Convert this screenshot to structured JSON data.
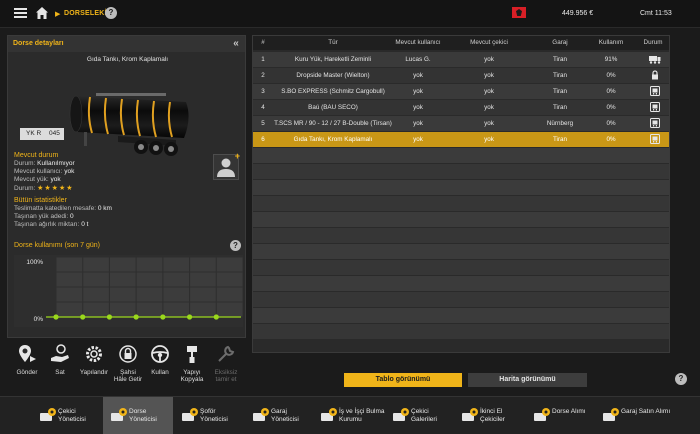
{
  "topbar": {
    "breadcrumb": "DORSELEKİM",
    "breadcrumb_sep": "▶",
    "help": "?",
    "money": "449.956 €",
    "time": "Cmt 11:53"
  },
  "left_panel": {
    "title": "Dorse detayları",
    "collapse": "«",
    "trailer_name": "Gıda Tankı, Krom Kaplamalı",
    "plate": {
      "country": "YK R",
      "number": "045"
    },
    "status": {
      "title": "Mevcut durum",
      "rows": [
        {
          "label": "Durum:",
          "value": "Kullanılmıyor"
        },
        {
          "label": "Mevcut kullanıcı:",
          "value": "yok"
        },
        {
          "label": "Mevcut yük:",
          "value": "yok"
        },
        {
          "label": "Durum:",
          "value": "★★★★★"
        }
      ]
    },
    "stats": {
      "title": "Bütün istatistikler",
      "rows": [
        {
          "label": "Teslimatta katedilen mesafe:",
          "value": "0 km"
        },
        {
          "label": "Taşınan yük adedi:",
          "value": "0"
        },
        {
          "label": "Taşınan ağırlık miktarı:",
          "value": "0 t"
        }
      ]
    },
    "usage": {
      "title": "Dorse kullanımı (son 7 gün)",
      "help": "?",
      "y_max_label": "100%",
      "y_min_label": "0%"
    }
  },
  "chart_data": {
    "type": "line",
    "title": "Dorse kullanımı (son 7 gün)",
    "x": [
      1,
      2,
      3,
      4,
      5,
      6,
      7
    ],
    "values": [
      0,
      0,
      0,
      0,
      0,
      0,
      0
    ],
    "ylim": [
      0,
      100
    ],
    "ytick_labels": [
      "100%",
      "0%"
    ],
    "color": "#9ad81c"
  },
  "actions": [
    {
      "name": "send",
      "label": "Gönder",
      "icon": "map-pin-send-icon",
      "enabled": true
    },
    {
      "name": "sell",
      "label": "Sat",
      "icon": "hand-coin-icon",
      "enabled": true
    },
    {
      "name": "configure",
      "label": "Yapılandır",
      "icon": "gear-icon",
      "enabled": true
    },
    {
      "name": "personal",
      "label": "Şahsi Hâle Getir",
      "icon": "lock-steering-icon",
      "enabled": true
    },
    {
      "name": "use",
      "label": "Kullan",
      "icon": "steering-wheel-icon",
      "enabled": true
    },
    {
      "name": "paint-copy",
      "label": "Yapıyı Kopyala",
      "icon": "paint-brush-icon",
      "enabled": true
    },
    {
      "name": "repair",
      "label": "Eksiksiz tamir et",
      "icon": "wrench-icon",
      "enabled": false
    }
  ],
  "table": {
    "columns": [
      "#",
      "Tür",
      "Mevcut kullanıcı",
      "Mevcut çekici",
      "Garaj",
      "Kullanım",
      "Durum"
    ],
    "rows": [
      {
        "n": "1",
        "type": "Kuru Yük, Hareketli Zeminli",
        "user": "Lucas G.",
        "truck": "yok",
        "garage": "Tiran",
        "usage": "91%",
        "status_icon": "truck-trailer-icon"
      },
      {
        "n": "2",
        "type": "Dropside Master (Wielton)",
        "user": "yok",
        "truck": "yok",
        "garage": "Tiran",
        "usage": "0%",
        "status_icon": "lock-icon"
      },
      {
        "n": "3",
        "type": "S.BO EXPRESS (Schmitz Cargobull)",
        "user": "yok",
        "truck": "yok",
        "garage": "Tiran",
        "usage": "0%",
        "status_icon": "trailer-parked-icon"
      },
      {
        "n": "4",
        "type": "Baú (BAU SECO)",
        "user": "yok",
        "truck": "yok",
        "garage": "Tiran",
        "usage": "0%",
        "status_icon": "trailer-parked-icon"
      },
      {
        "n": "5",
        "type": "T.SCS MR / 90 - 12 / 27 B-Double (Tirsan)",
        "user": "yok",
        "truck": "yok",
        "garage": "Nürnberg",
        "usage": "0%",
        "status_icon": "trailer-parked-icon"
      },
      {
        "n": "6",
        "type": "Gıda Tankı, Krom Kaplamalı",
        "user": "yok",
        "truck": "yok",
        "garage": "Tiran",
        "usage": "0%",
        "status_icon": "trailer-parked-icon",
        "selected": true
      }
    ]
  },
  "view_buttons": {
    "table": "Tablo görünümü",
    "map": "Harita görünümü",
    "help": "?"
  },
  "bottom_nav": [
    {
      "label": "Çekici Yöneticisi",
      "icon": "truck-gear-icon"
    },
    {
      "label": "Dorse Yöneticisi",
      "icon": "trailer-gear-icon",
      "active": true
    },
    {
      "label": "Şoför Yöneticisi",
      "icon": "driver-gear-icon"
    },
    {
      "label": "Garaj Yöneticisi",
      "icon": "garage-gear-icon"
    },
    {
      "label": "İş ve İşçi Bulma Kurumu",
      "icon": "recruitment-icon"
    },
    {
      "label": "Çekici Galerileri",
      "icon": "truck-dealer-icon"
    },
    {
      "label": "İkinci El Çekiciler",
      "icon": "used-truck-icon"
    },
    {
      "label": "Dorse Alımı",
      "icon": "trailer-buy-icon"
    },
    {
      "label": "Garaj Satın Alımı",
      "icon": "garage-buy-icon"
    }
  ]
}
